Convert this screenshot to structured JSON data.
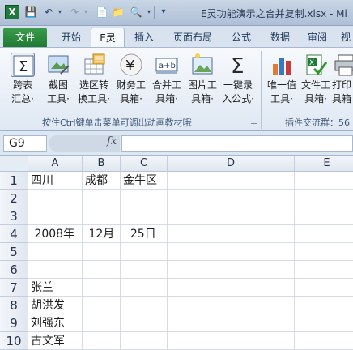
{
  "app": {
    "title": "E灵功能演示之合并复制.xlsx - Mi",
    "icon_letter": "X"
  },
  "qat": [
    "save-icon",
    "undo-icon",
    "redo-icon",
    "new-icon",
    "open-icon",
    "print-preview-icon",
    "customize-icon"
  ],
  "tabs": [
    {
      "label": "文件",
      "active": false,
      "file": true
    },
    {
      "label": "开始",
      "active": false
    },
    {
      "label": "E灵",
      "active": true
    },
    {
      "label": "插入",
      "active": false
    },
    {
      "label": "页面布局",
      "active": false
    },
    {
      "label": "公式",
      "active": false
    },
    {
      "label": "数据",
      "active": false
    },
    {
      "label": "审阅",
      "active": false
    },
    {
      "label": "视",
      "active": false
    }
  ],
  "ribbon": {
    "buttons": [
      {
        "line1": "跨表",
        "line2": "汇总·",
        "icon": "sigma-table-icon"
      },
      {
        "line1": "截图",
        "line2": "工具·",
        "icon": "screenshot-icon"
      },
      {
        "line1": "选区转",
        "line2": "换工具·",
        "icon": "range-convert-icon"
      },
      {
        "line1": "财务工",
        "line2": "具箱·",
        "icon": "yen-icon"
      },
      {
        "line1": "合并工",
        "line2": "具箱·",
        "icon": "merge-icon"
      },
      {
        "line1": "图片工",
        "line2": "具箱·",
        "icon": "picture-icon"
      },
      {
        "line1": "一键录",
        "line2": "入公式·",
        "icon": "sigma-icon"
      },
      {
        "line1": "唯一值",
        "line2": "工具·",
        "icon": "unique-chart-icon"
      },
      {
        "line1": "文件工",
        "line2": "具箱·",
        "icon": "file-check-icon"
      },
      {
        "line1": "打印",
        "line2": "具箱",
        "icon": "printer-icon"
      }
    ],
    "group1_label": "按住Ctrl键单击菜单可调出动画教材哦",
    "group2_label": "插件交流群：56"
  },
  "formula_bar": {
    "name_box": "G9",
    "fx": "fx",
    "formula": ""
  },
  "sheet": {
    "columns": [
      "A",
      "B",
      "C",
      "D",
      "E"
    ],
    "rows": [
      {
        "num": "1",
        "cells": [
          "四川",
          "成都",
          "金牛区",
          "",
          ""
        ]
      },
      {
        "num": "2",
        "cells": [
          "",
          "",
          "",
          "",
          ""
        ]
      },
      {
        "num": "3",
        "cells": [
          "",
          "",
          "",
          "",
          ""
        ]
      },
      {
        "num": "4",
        "cells": [
          " 2008年",
          " 12月",
          "  25日",
          "",
          ""
        ]
      },
      {
        "num": "5",
        "cells": [
          "",
          "",
          "",
          "",
          ""
        ]
      },
      {
        "num": "6",
        "cells": [
          "",
          "",
          "",
          "",
          ""
        ]
      },
      {
        "num": "7",
        "cells": [
          "张兰",
          "",
          "",
          "",
          ""
        ]
      },
      {
        "num": "8",
        "cells": [
          "胡洪发",
          "",
          "",
          "",
          ""
        ]
      },
      {
        "num": "9",
        "cells": [
          "刘强东",
          "",
          "",
          "",
          ""
        ]
      },
      {
        "num": "10",
        "cells": [
          "古文军",
          "",
          "",
          "",
          ""
        ]
      }
    ]
  },
  "colors": {
    "file_tab": "#2a8a3c",
    "accent": "#1e395b"
  }
}
